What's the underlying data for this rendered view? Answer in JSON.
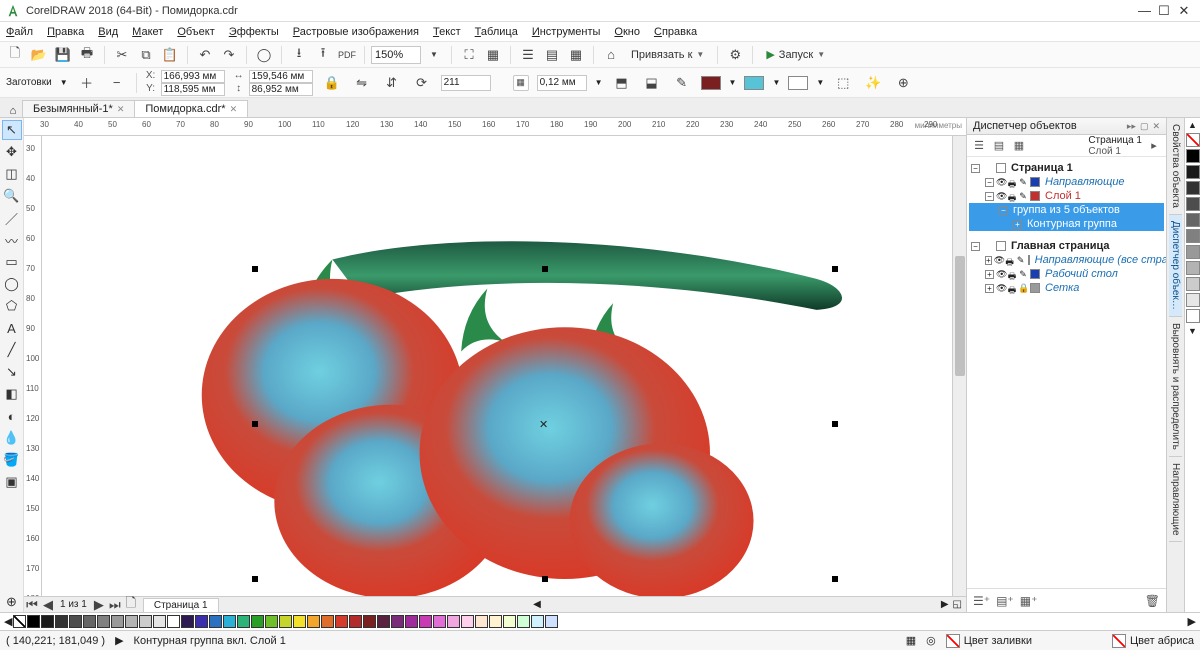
{
  "title": "CorelDRAW 2018 (64-Bit) - Помидорка.cdr",
  "menus": [
    "Файл",
    "Правка",
    "Вид",
    "Макет",
    "Объект",
    "Эффекты",
    "Растровые изображения",
    "Текст",
    "Таблица",
    "Инструменты",
    "Окно",
    "Справка"
  ],
  "zoom": "150%",
  "snap_label": "Привязать к",
  "launch_label": "Запуск",
  "page_presets": "Заготовки",
  "coords": {
    "x_label": "X:",
    "y_label": "Y:",
    "x": "166,993 мм",
    "y": "118,595 мм",
    "w_sym": "↔",
    "h_sym": "↕",
    "w": "159,546 мм",
    "h": "86,952 мм"
  },
  "rotation": "211",
  "outline": "0,12 мм",
  "color_fill": "#7a2020",
  "color_aux": "#58c2d6",
  "doc_tabs": [
    {
      "label": "Безымянный-1*",
      "active": false
    },
    {
      "label": "Помидорка.cdr*",
      "active": true
    }
  ],
  "pagenav": {
    "text": "1 из 1",
    "page_tab": "Страница 1"
  },
  "ruler_units": "миллиметры",
  "ruler_ticks": [
    30,
    40,
    50,
    60,
    70,
    80,
    90,
    100,
    110,
    120,
    130,
    140,
    150,
    160,
    170,
    180,
    190,
    200,
    210,
    220,
    230,
    240,
    250,
    260,
    270,
    280,
    290
  ],
  "vruler_ticks": [
    30,
    40,
    50,
    60,
    70,
    80,
    90,
    100,
    110,
    120,
    130,
    140,
    150,
    160,
    170,
    180
  ],
  "panel": {
    "title": "Диспетчер объектов",
    "strip_title": "Страница 1",
    "strip_layer": "Слой 1",
    "rows": [
      {
        "indent": 0,
        "open": true,
        "eyes": false,
        "square": "#fff",
        "text": "Страница 1",
        "bold": true
      },
      {
        "indent": 1,
        "open": true,
        "eyes": true,
        "square": "#1a3fb0",
        "em": "Направляющие"
      },
      {
        "indent": 1,
        "open": true,
        "eyes": true,
        "square": "#c23030",
        "text": "Слой 1",
        "red": true
      },
      {
        "indent": 2,
        "open": true,
        "sel": true,
        "text": "группа из 5 объектов"
      },
      {
        "indent": 3,
        "open": false,
        "sel": true,
        "text": "Контурная группа"
      },
      {
        "gap": true
      },
      {
        "indent": 0,
        "open": true,
        "eyes": false,
        "square": "#fff",
        "text": "Главная страница",
        "bold": true
      },
      {
        "indent": 1,
        "open": false,
        "eyes": true,
        "square": "#1a3fb0",
        "em": "Направляющие (все страницы)"
      },
      {
        "indent": 1,
        "open": false,
        "eyes": true,
        "square": "#1a3fb0",
        "em": "Рабочий стол"
      },
      {
        "indent": 1,
        "open": false,
        "eyes": true,
        "locked": true,
        "square": "#9a9a9a",
        "em": "Сетка"
      }
    ]
  },
  "side_tabs": [
    "Свойства объекта",
    "Диспетчер объек…",
    "Выровнять и распределить",
    "Направляющие"
  ],
  "grays": [
    "#000",
    "#1a1a1a",
    "#333",
    "#4d4d4d",
    "#666",
    "#808080",
    "#999",
    "#b3b3b3",
    "#ccc",
    "#e6e6e6",
    "#fff"
  ],
  "palette": [
    "#000",
    "#1a1a1a",
    "#333",
    "#4d4d4d",
    "#666",
    "#808080",
    "#999",
    "#b3b3b3",
    "#ccc",
    "#e6e6e6",
    "#fff",
    "#2e1a52",
    "#3b2fae",
    "#2a71c2",
    "#2bb0d6",
    "#2bb37a",
    "#28a028",
    "#6fbf2b",
    "#c5d52b",
    "#f2e02b",
    "#f2a62b",
    "#e06e2b",
    "#d53b2b",
    "#b32b2b",
    "#7a2020",
    "#5a2040",
    "#7a2b7a",
    "#a02b9a",
    "#c83bb3",
    "#e06ed5",
    "#f2a6e0",
    "#ffd0ec",
    "#ffe6d0",
    "#fff2d0",
    "#f2ffd0",
    "#d0ffd6",
    "#d0f2ff",
    "#d0e0ff"
  ],
  "status": {
    "coords": "( 140,221; 181,049 )",
    "arrow": "▶",
    "desc": "Контурная группа вкл. Слой 1",
    "fill_label": "Цвет заливки",
    "outline_label": "Цвет абриса"
  }
}
